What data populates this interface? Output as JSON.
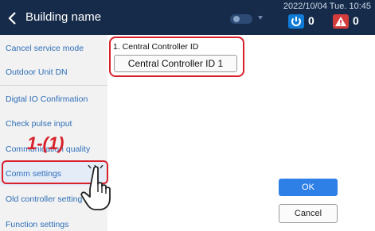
{
  "header": {
    "title": "Building name",
    "datetime": "2022/10/04 Tue. 10:45",
    "power_count": "0",
    "warning_count": "0"
  },
  "sidebar": {
    "items": [
      {
        "label": "Cancel service mode"
      },
      {
        "label": "Outdoor Unit DN"
      },
      {
        "label": "Digtal IO Confirmation"
      },
      {
        "label": "Check pulse input"
      },
      {
        "label": "Communication quality"
      },
      {
        "label": "Comm settings"
      },
      {
        "label": "Old controller setting"
      },
      {
        "label": "Function settings"
      }
    ]
  },
  "main": {
    "cc_label": "1. Central Controller ID",
    "cc_value": "Central Controller ID 1",
    "ok_label": "OK",
    "cancel_label": "Cancel"
  },
  "annotation": {
    "step": "1-(1)"
  },
  "colors": {
    "header_bg": "#162b4a",
    "accent": "#2f80e6",
    "highlight": "#d8202a",
    "sidebar_text": "#2f6fb8"
  },
  "icons": {
    "back": "chevron-left-icon",
    "power": "power-icon",
    "warning": "warning-icon",
    "hand": "pointing-hand-icon"
  }
}
